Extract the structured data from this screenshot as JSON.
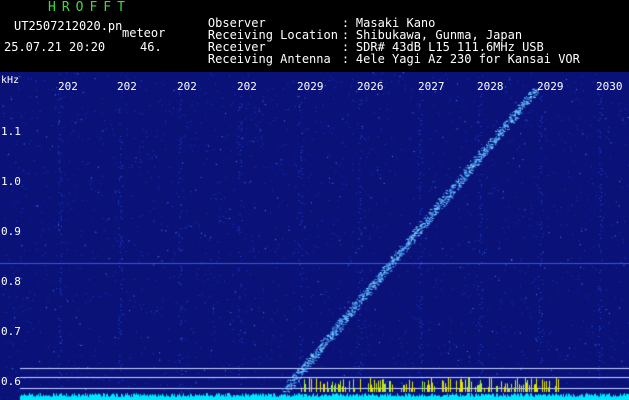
{
  "header": {
    "app_title": "HROFFT",
    "file_name": "UT2507212020.pn",
    "meteor_label": "meteor",
    "datetime": "25.07.21 20:20",
    "count": "46.",
    "rows": [
      {
        "label": "Observer",
        "value": "Masaki Kano"
      },
      {
        "label": "Receiving Location",
        "value": "Shibukawa, Gunma, Japan"
      },
      {
        "label": "Receiver",
        "value": "SDR# 43dB L15 111.6MHz USB"
      },
      {
        "label": "Receiving Antenna",
        "value": "4ele Yagi Az 230 for Kansai VOR"
      }
    ]
  },
  "spectrogram": {
    "frequency_unit": "kHz",
    "frequency_labels": [
      "1.1",
      "1.0",
      "0.9",
      "0.8",
      "0.7",
      "0.6"
    ],
    "time_labels": [
      "202",
      "202",
      "202",
      "202",
      "2029",
      "2026",
      "2027",
      "2028",
      "2029",
      "2030"
    ],
    "colors": {
      "background": "#0a1278",
      "trail": "#7fd6ff",
      "noise_floor": "#00e6ff",
      "bursts": "#e6e600"
    }
  }
}
